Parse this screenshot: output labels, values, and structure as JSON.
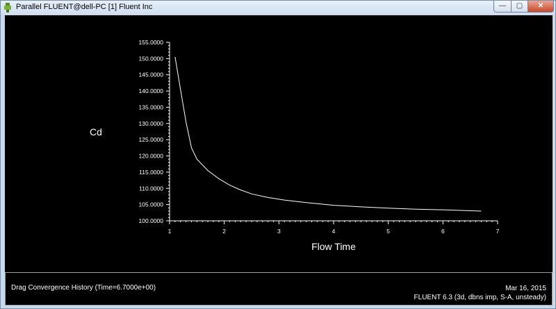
{
  "window": {
    "title": "Parallel FLUENT@dell-PC [1] Fluent Inc",
    "minimize_symbol": "—",
    "maximize_symbol": "▢",
    "close_symbol": "✕",
    "icon": "fluent-app-icon"
  },
  "colors": {
    "plot_background": "#000000",
    "curve": "#ffffff",
    "axis": "#ffffff",
    "text": "#ffffff"
  },
  "chart_data": {
    "type": "line",
    "title": "",
    "xlabel": "Flow Time",
    "ylabel": "Cd",
    "xlim": [
      1,
      7
    ],
    "ylim": [
      100,
      155
    ],
    "xticks": [
      1,
      2,
      3,
      4,
      5,
      6,
      7
    ],
    "yticks": [
      "100.0000",
      "105.0000",
      "110.0000",
      "115.0000",
      "120.0000",
      "125.0000",
      "130.0000",
      "135.0000",
      "140.0000",
      "145.0000",
      "150.0000",
      "155.0000"
    ],
    "grid": false,
    "series": [
      {
        "x": [
          1.1,
          1.2,
          1.3,
          1.4,
          1.5,
          1.7,
          1.9,
          2.1,
          2.3,
          2.5,
          2.8,
          3.1,
          3.5,
          4.0,
          4.5,
          5.0,
          5.5,
          6.0,
          6.5,
          6.7
        ],
        "y": [
          150.5,
          140.5,
          130.5,
          122.5,
          119.0,
          115.5,
          113.0,
          111.0,
          109.5,
          108.3,
          107.2,
          106.4,
          105.6,
          104.8,
          104.3,
          103.9,
          103.6,
          103.4,
          103.1,
          103.0
        ]
      }
    ]
  },
  "info": {
    "history_label": "Drag Convergence History  (Time=6.7000e+00)",
    "date": "Mar 16, 2015",
    "solver": "FLUENT 6.3 (3d, dbns imp, S-A, unsteady)"
  }
}
